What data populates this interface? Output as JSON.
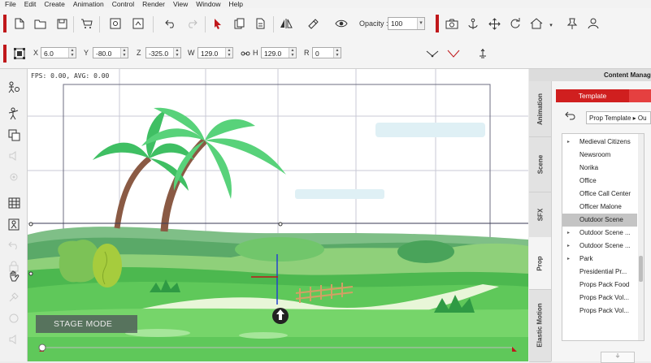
{
  "menu": [
    "File",
    "Edit",
    "Create",
    "Animation",
    "Control",
    "Render",
    "View",
    "Window",
    "Help"
  ],
  "toolbar": {
    "opacity_label": "Opacity :",
    "opacity_value": "100"
  },
  "transform": {
    "x_label": "X",
    "x_value": "6.0",
    "y_label": "Y",
    "y_value": "-80.0",
    "z_label": "Z",
    "z_value": "-325.0",
    "w_label": "W",
    "w_value": "129.0",
    "h_label": "H",
    "h_value": "129.0",
    "r_label": "R",
    "r_value": "0"
  },
  "stage": {
    "fps_text": "FPS: 0.00, AVG: 0.00",
    "mode_label": "STAGE MODE"
  },
  "panel": {
    "title": "Content Manag",
    "tabs": [
      "Animation",
      "Scene",
      "SFX",
      "Prop",
      "Elastic Motion"
    ],
    "active_tab": "Prop",
    "template_tab": "Template",
    "breadcrumb": "Prop Template ▸ Ou",
    "items": [
      {
        "label": "Medieval Citizens",
        "arrow": "▸"
      },
      {
        "label": "Newsroom",
        "arrow": ""
      },
      {
        "label": "Norika",
        "arrow": ""
      },
      {
        "label": "Office",
        "arrow": ""
      },
      {
        "label": "Office Call Center",
        "arrow": ""
      },
      {
        "label": "Officer Malone",
        "arrow": ""
      },
      {
        "label": "Outdoor Scene",
        "arrow": "",
        "selected": true
      },
      {
        "label": "Outdoor Scene ...",
        "arrow": "▸"
      },
      {
        "label": "Outdoor Scene ...",
        "arrow": "▸"
      },
      {
        "label": "Park",
        "arrow": "▸"
      },
      {
        "label": "Presidential Pr...",
        "arrow": ""
      },
      {
        "label": "Props Pack Food",
        "arrow": ""
      },
      {
        "label": "Props Pack Vol...",
        "arrow": ""
      },
      {
        "label": "Props Pack Vol...",
        "arrow": ""
      }
    ]
  },
  "colors": {
    "accent": "#c0181b",
    "grass": "#5fc85a",
    "sky": "#ffffff"
  }
}
